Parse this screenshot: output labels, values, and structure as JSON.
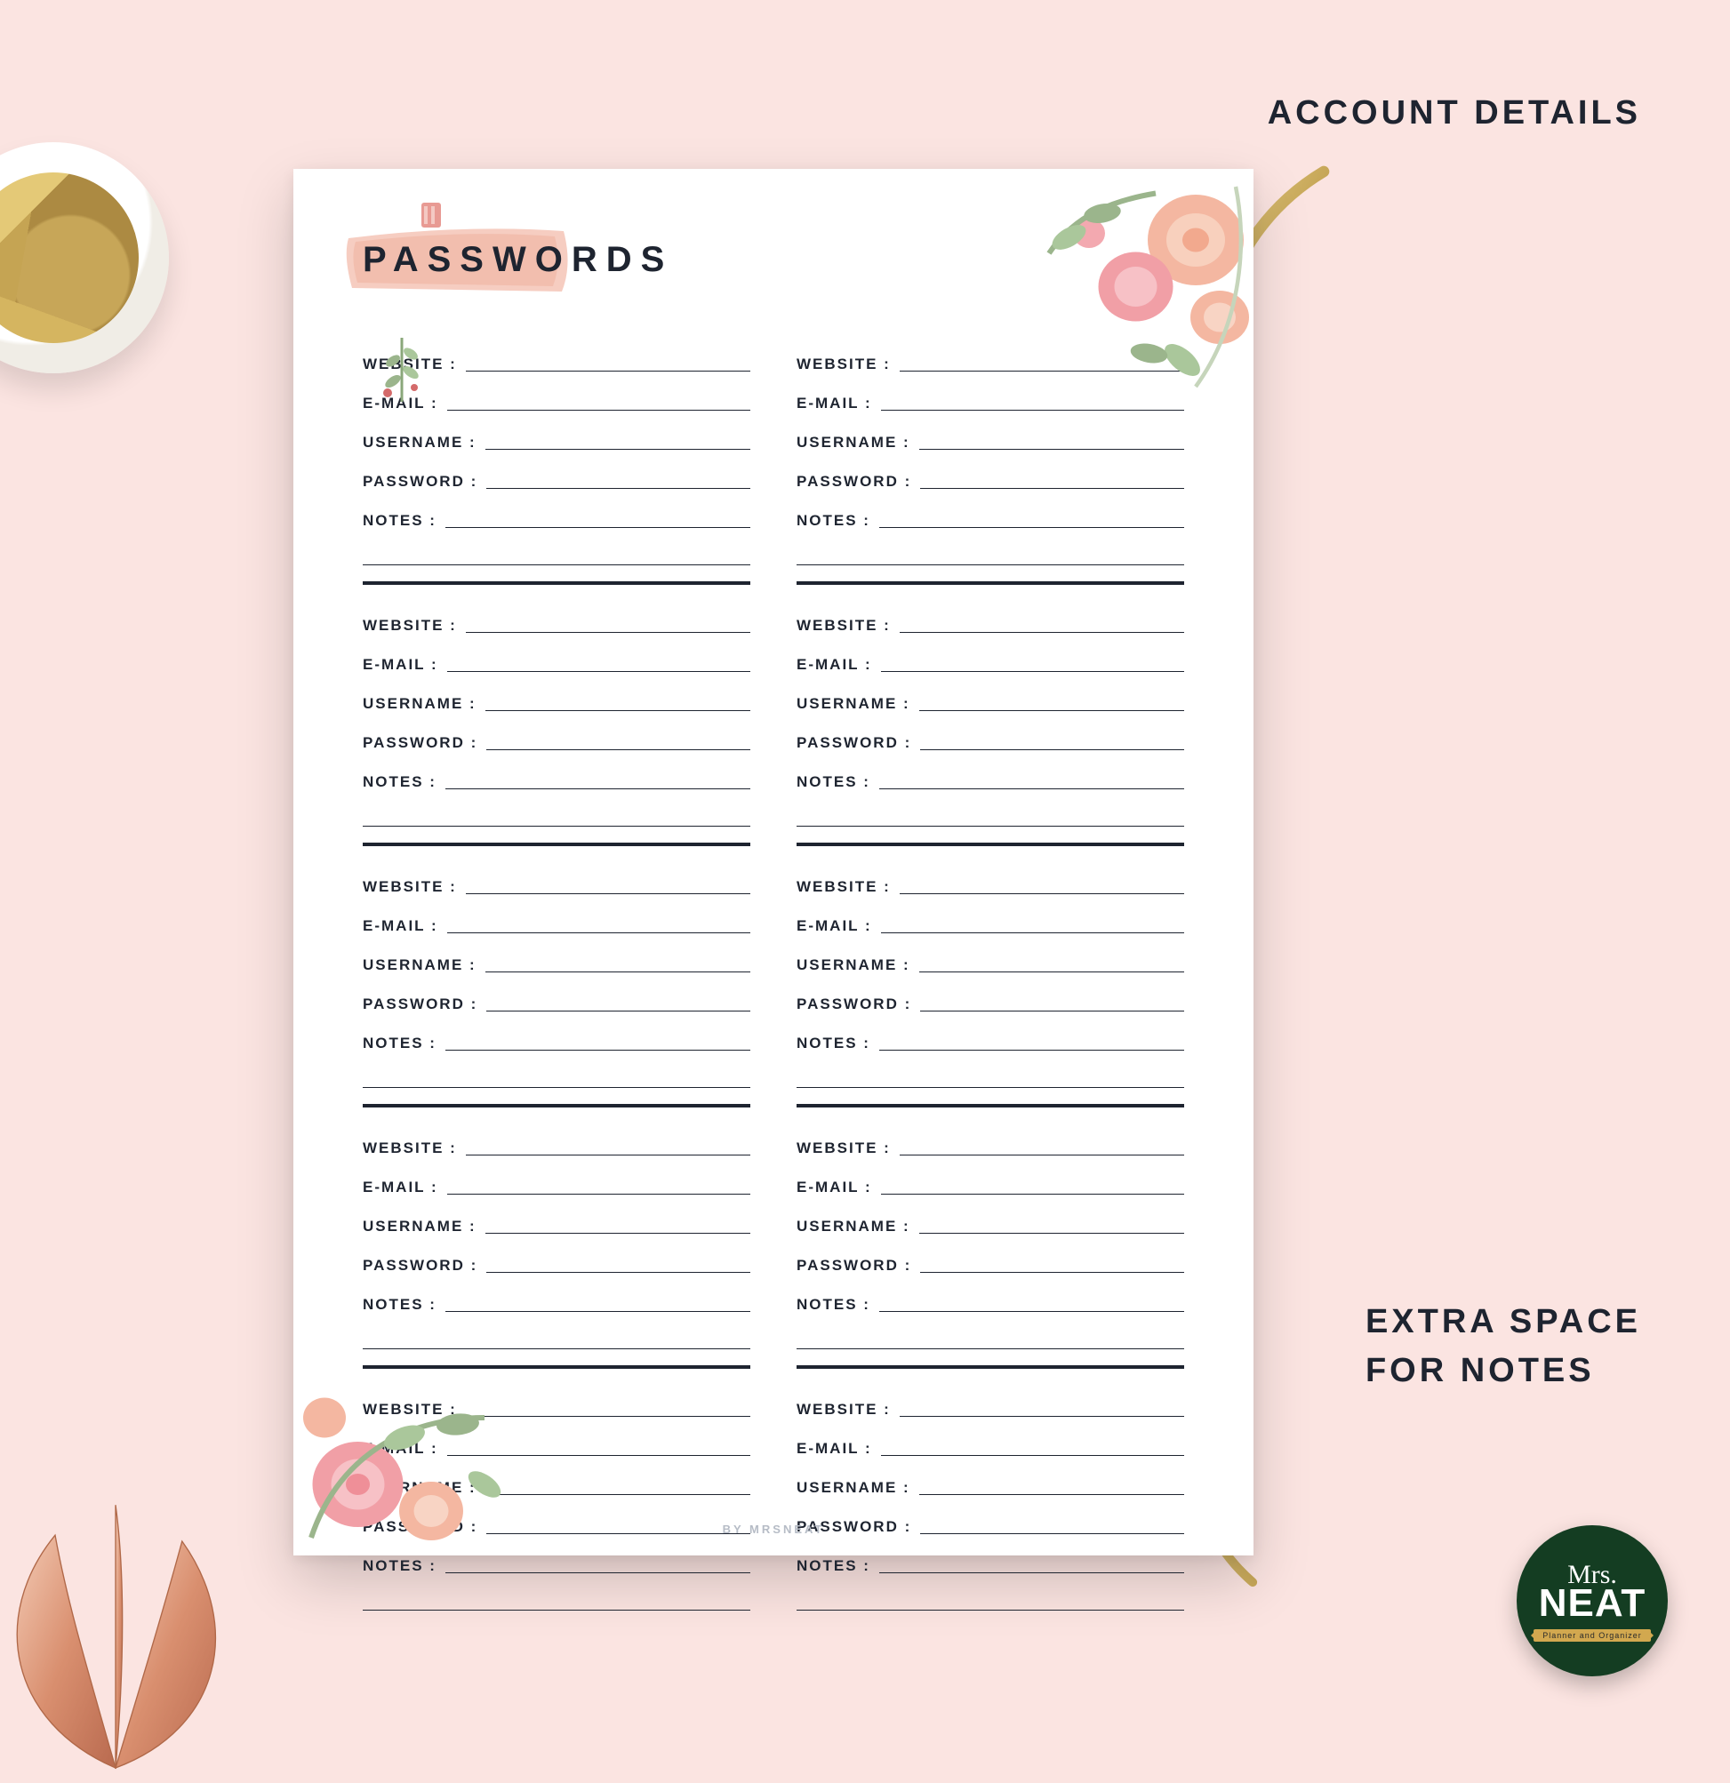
{
  "page": {
    "title": "PASSWORDS",
    "credit": "BY MRSNEAT",
    "field_labels": {
      "website": "WEBSITE :",
      "email": "E-MAIL :",
      "username": "USERNAME :",
      "password": "PASSWORD :",
      "notes": "NOTES :"
    },
    "blocks_per_column": 5,
    "columns": 2
  },
  "callouts": {
    "top": "ACCOUNT DETAILS",
    "bottom_line1": "EXTRA SPACE",
    "bottom_line2": "FOR NOTES"
  },
  "brand": {
    "line1": "Mrs.",
    "line2": "NEAT",
    "ribbon": "Planner and Organizer"
  },
  "colors": {
    "background": "#fbe4e1",
    "ink": "#1e2430",
    "badge": "#143d22",
    "gold": "#d2a84f"
  }
}
